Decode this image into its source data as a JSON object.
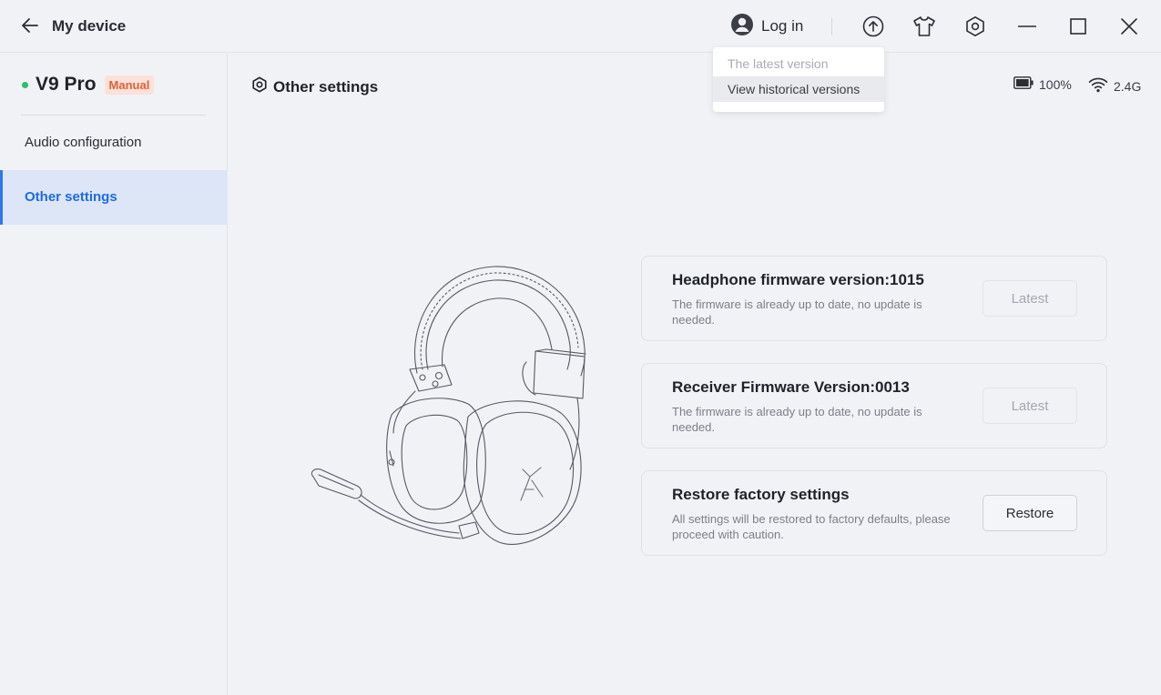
{
  "titlebar": {
    "title": "My device",
    "login_label": "Log in"
  },
  "dropdown": {
    "items": [
      {
        "label": "The latest version",
        "disabled": true
      },
      {
        "label": "View historical versions",
        "disabled": false
      }
    ]
  },
  "sidebar": {
    "device_name": "V9 Pro",
    "mode_badge": "Manual",
    "items": [
      {
        "label": "Audio configuration",
        "active": false
      },
      {
        "label": "Other settings",
        "active": true
      }
    ]
  },
  "main": {
    "section_title": "Other settings",
    "battery": "100%",
    "connection": "2.4G",
    "cards": [
      {
        "title": "Headphone firmware version:1015",
        "description": "The firmware is already up to date, no update is needed.",
        "button": "Latest"
      },
      {
        "title": "Receiver Firmware Version:0013",
        "description": "The firmware is already up to date, no update is needed.",
        "button": "Latest"
      },
      {
        "title": "Restore factory settings",
        "description": "All settings will be restored to factory defaults, please proceed with caution.",
        "button": "Restore"
      }
    ]
  },
  "colors": {
    "accent": "#1f6ce0",
    "online": "#2dbd6e",
    "badge_text": "#e2603a",
    "badge_bg": "#fbe1d8"
  }
}
